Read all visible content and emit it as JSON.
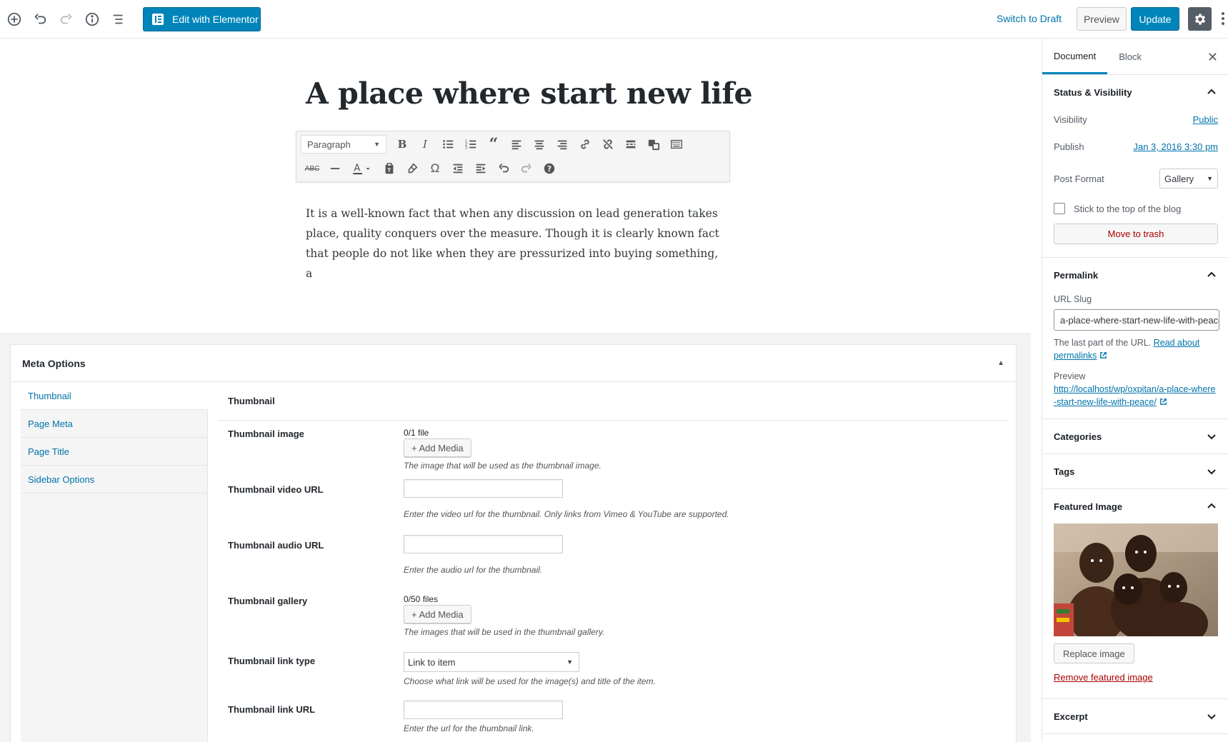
{
  "toolbar": {
    "elementor_label": "Edit with Elementor",
    "switch_draft": "Switch to Draft",
    "preview": "Preview",
    "update": "Update"
  },
  "editor": {
    "title": "A place where start new life",
    "paragraph_select": "Paragraph",
    "content": "It is a well-known fact that when any discussion on lead generation takes place, quality conquers over the measure. Though it is clearly known fact that people do not like when they are pressurized into buying something, a"
  },
  "meta": {
    "title": "Meta Options",
    "nav": [
      "Thumbnail",
      "Page Meta",
      "Page Title",
      "Sidebar Options"
    ],
    "panel_title": "Thumbnail",
    "fields": {
      "image_label": "Thumbnail image",
      "image_count": "0/1 file",
      "add_media": "+ Add Media",
      "image_desc": "The image that will be used as the thumbnail image.",
      "video_label": "Thumbnail video URL",
      "video_desc": "Enter the video url for the thumbnail. Only links from Vimeo & YouTube are supported.",
      "audio_label": "Thumbnail audio URL",
      "audio_desc": "Enter the audio url for the thumbnail.",
      "gallery_label": "Thumbnail gallery",
      "gallery_count": "0/50 files",
      "gallery_desc": "The images that will be used in the thumbnail gallery.",
      "link_type_label": "Thumbnail link type",
      "link_type_value": "Link to item",
      "link_type_desc": "Choose what link will be used for the image(s) and title of the item.",
      "link_url_label": "Thumbnail link URL",
      "link_url_desc": "Enter the url for the thumbnail link."
    }
  },
  "sidebar": {
    "tabs": [
      "Document",
      "Block"
    ],
    "status": {
      "title": "Status & Visibility",
      "visibility_label": "Visibility",
      "visibility_value": "Public",
      "publish_label": "Publish",
      "publish_value": "Jan 3, 2016 3:30 pm",
      "format_label": "Post Format",
      "format_value": "Gallery",
      "sticky_label": "Stick to the top of the blog",
      "trash": "Move to trash"
    },
    "permalink": {
      "title": "Permalink",
      "slug_label": "URL Slug",
      "slug_value": "a-place-where-start-new-life-with-peace",
      "help_text": "The last part of the URL.",
      "help_link": "Read about permalinks",
      "preview_label": "Preview",
      "preview_url": "http://localhost/wp/oxpitan/a-place-where-start-new-life-with-peace/"
    },
    "categories": "Categories",
    "tags": "Tags",
    "featured": {
      "title": "Featured Image",
      "replace": "Replace image",
      "remove": "Remove featured image"
    },
    "excerpt": "Excerpt"
  },
  "colors": {
    "primary": "#0085ba",
    "link": "#0073aa",
    "danger": "#a00"
  }
}
